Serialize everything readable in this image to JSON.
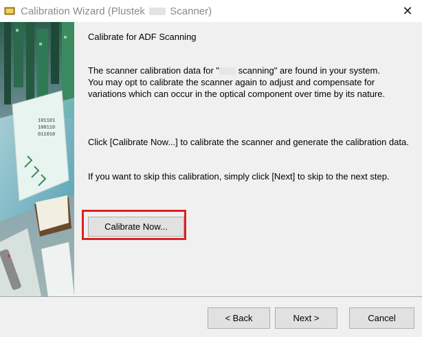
{
  "window": {
    "title_prefix": "Calibration Wizard (Plustek",
    "title_suffix": "Scanner)"
  },
  "header": {
    "close_glyph": "✕"
  },
  "main": {
    "heading": "Calibrate for ADF Scanning",
    "para1_line1_a": "The scanner calibration data for \"",
    "para1_line1_b": " scanning\" are found in your system.",
    "para1_rest": "You may opt to calibrate the scanner again to adjust and compensate for variations which can occur in the optical component over time by its nature.",
    "para2": "Click [Calibrate Now...] to calibrate the scanner and generate the calibration data.",
    "para3": "If you want to skip this calibration, simply click [Next] to skip to the next step.",
    "calibrate_button": "Calibrate Now..."
  },
  "footer": {
    "back_button": "< Back",
    "next_button": "Next >",
    "cancel_button": "Cancel"
  },
  "colors": {
    "highlight": "#e02020",
    "window_bg": "#f0f0f0"
  },
  "icons": {
    "app": "scanner-app-icon",
    "close": "close-icon"
  }
}
